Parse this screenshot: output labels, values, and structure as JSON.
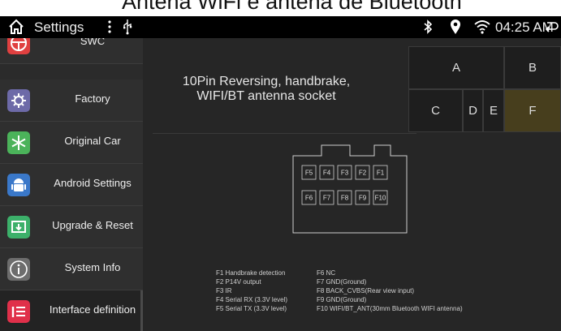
{
  "caption": "Antena WiFi e antena de Bluetooth",
  "statusbar": {
    "title": "Settings",
    "time": "04:25 AM",
    "icons": [
      "home-icon",
      "more-vert-icon",
      "usb-icon",
      "bluetooth-icon",
      "location-icon",
      "wifi-icon",
      "back-icon"
    ]
  },
  "sidebar": {
    "items": [
      {
        "label": "SWC",
        "icon": "steering-wheel-icon",
        "color": "#e04040"
      },
      {
        "label": "Factory",
        "icon": "gear-icon",
        "color": "#6d6aa8"
      },
      {
        "label": "Original Car",
        "icon": "snowflake-icon",
        "color": "#4bb35a"
      },
      {
        "label": "Android Settings",
        "icon": "android-icon",
        "color": "#3a78c9"
      },
      {
        "label": "Upgrade & Reset",
        "icon": "upgrade-icon",
        "color": "#3cb06a"
      },
      {
        "label": "System Info",
        "icon": "info-icon",
        "color": "#6d6d6d"
      },
      {
        "label": "Interface definition",
        "icon": "list-icon",
        "color": "#e0304a"
      }
    ]
  },
  "main": {
    "heading_line1": "10Pin Reversing, handbrake,",
    "heading_line2": "WIFI/BT antenna socket",
    "pins_top": [
      "A",
      "B"
    ],
    "pins_bottom": [
      "C",
      "D",
      "E",
      "F"
    ],
    "selected_pin": "F",
    "connector_row1": [
      "F5",
      "F4",
      "F3",
      "F2",
      "F1"
    ],
    "connector_row2": [
      "F6",
      "F7",
      "F8",
      "F9",
      "F10"
    ],
    "legend_left": [
      "F1 Handbrake detection",
      "F2 P14V output",
      "F3 IR",
      "F4 Serial RX (3.3V level)",
      "F5 Serial TX (3.3V level)"
    ],
    "legend_right": [
      "F6 NC",
      "F7 GND(Ground)",
      "F8 BACK_CVBS(Rear view input)",
      "F9 GND(Ground)",
      "F10 WIFI/BT_ANT(30mm Bluetooth WIFI antenna)"
    ]
  }
}
